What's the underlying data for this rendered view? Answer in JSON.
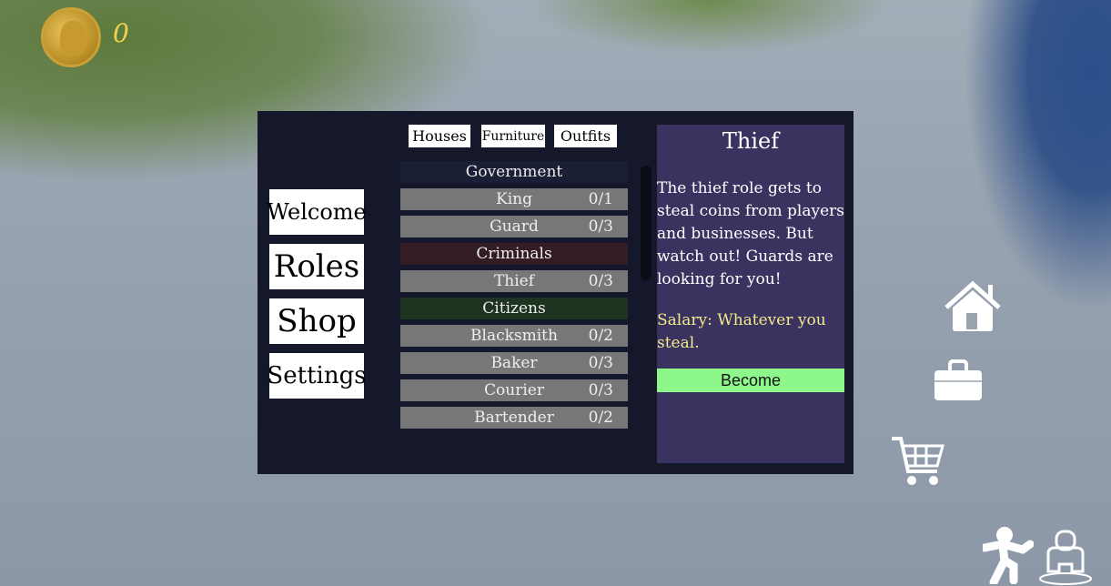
{
  "hud": {
    "coins": "0",
    "coin_icon": "gold-coin-icon"
  },
  "nav": [
    {
      "label": "Welcome"
    },
    {
      "label": "Roles"
    },
    {
      "label": "Shop"
    },
    {
      "label": "Settings"
    }
  ],
  "tabs": [
    {
      "label": "Houses"
    },
    {
      "label": "Furniture"
    },
    {
      "label": "Outfits"
    }
  ],
  "roles": [
    {
      "type": "header",
      "label": "Government",
      "color": "#1b1f36"
    },
    {
      "type": "role",
      "label": "King",
      "count": "0/1"
    },
    {
      "type": "role",
      "label": "Guard",
      "count": "0/3"
    },
    {
      "type": "header",
      "label": "Criminals",
      "color": "#341c25"
    },
    {
      "type": "role",
      "label": "Thief",
      "count": "0/3"
    },
    {
      "type": "header",
      "label": "Citizens",
      "color": "#1e3320"
    },
    {
      "type": "role",
      "label": "Blacksmith",
      "count": "0/2"
    },
    {
      "type": "role",
      "label": "Baker",
      "count": "0/3"
    },
    {
      "type": "role",
      "label": "Courier",
      "count": "0/3"
    },
    {
      "type": "role",
      "label": "Bartender",
      "count": "0/2"
    }
  ],
  "detail": {
    "title": "Thief",
    "description": "The thief role gets to steal coins from players and businesses. But watch out! Guards are looking for you!",
    "salary": "Salary: Whatever you steal.",
    "button": "Become"
  },
  "side_icons": [
    "house-icon",
    "briefcase-icon",
    "shopping-cart-icon",
    "sprint-icon",
    "avatar-icon"
  ]
}
